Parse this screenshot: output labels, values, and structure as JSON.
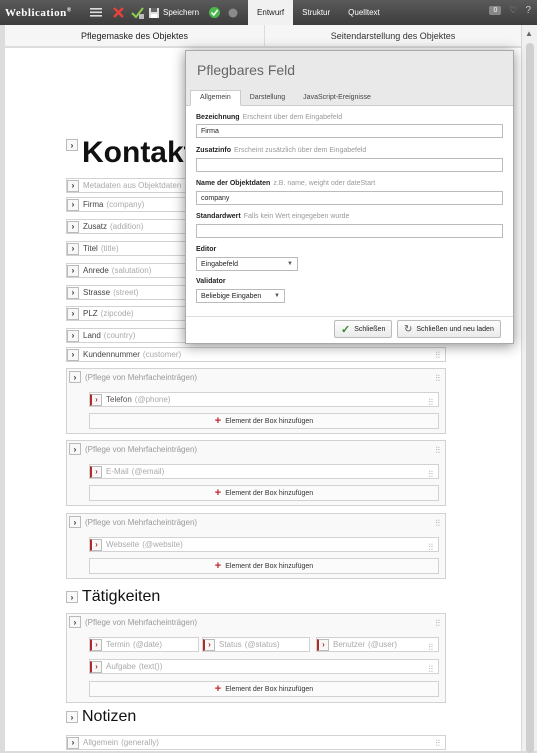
{
  "app": {
    "logo": "Weblication",
    "save_label": "Speichern",
    "tabs": [
      {
        "label": "Entwurf",
        "active": true
      },
      {
        "label": "Struktur",
        "active": false
      },
      {
        "label": "Quelltext",
        "active": false
      }
    ],
    "badge_count": "0",
    "help_label": "?"
  },
  "panels": {
    "left_title": "Pflegemaske des Objektes",
    "right_title": "Seitendarstellung des Objektes"
  },
  "main": {
    "heading_kontakt": "Kontakt",
    "fields": [
      {
        "name": "Metadaten aus Objektdaten",
        "param": ""
      },
      {
        "name": "Firma",
        "param": "(company)"
      },
      {
        "name": "Zusatz",
        "param": "(addition)"
      },
      {
        "name": "Titel",
        "param": "(title)"
      },
      {
        "name": "Anrede",
        "param": "(salutation)"
      },
      {
        "name": "Strasse",
        "param": "(street)"
      },
      {
        "name": "PLZ",
        "param": "(zipcode)"
      },
      {
        "name": "Land",
        "param": "(country)"
      },
      {
        "name": "Kundennummer",
        "param": "(customer)"
      }
    ],
    "box_title": "(Pflege von Mehrfacheinträgen)",
    "add_label": "Element der Box hinzufügen",
    "box_telefon": {
      "name": "Telefon",
      "param": "(@phone)"
    },
    "box_email": {
      "name": "E-Mail",
      "param": "(@email)"
    },
    "box_website": {
      "name": "Webseite",
      "param": "(@website)"
    },
    "heading_taetigkeiten": "Tätigkeiten",
    "termin": {
      "name": "Termin",
      "param": "(@date)"
    },
    "status": {
      "name": "Status",
      "param": "(@status)"
    },
    "benutzer": {
      "name": "Benutzer",
      "param": "(@user)"
    },
    "aufgabe": {
      "name": "Aufgabe",
      "param": "(text())"
    },
    "heading_notizen": "Notizen",
    "allgemein": {
      "name": "Allgemein",
      "param": "(generally)"
    }
  },
  "modal": {
    "title": "Pflegbares Feld",
    "tabs": [
      "Allgemein",
      "Darstellung",
      "JavaScript-Ereignisse"
    ],
    "bezeichnung_label": "Bezeichnung",
    "bezeichnung_hint": "Erscheint über dem Eingabefeld",
    "bezeichnung_value": "Firma",
    "zusatzinfo_label": "Zusatzinfo",
    "zusatzinfo_hint": "Erscheint zusätzlich über dem Eingabefeld",
    "zusatzinfo_value": "",
    "objektdaten_label": "Name der Objektdaten",
    "objektdaten_hint": "z.B. name, weight oder dateStart",
    "objektdaten_value": "company",
    "standardwert_label": "Standardwert",
    "standardwert_hint": "Falls kein Wert eingegeben wurde",
    "standardwert_value": "",
    "editor_label": "Editor",
    "editor_value": "Eingabefeld",
    "validator_label": "Validator",
    "validator_value": "Beliebige Eingaben",
    "close_label": "Schließen",
    "close_reload_label": "Schließen und neu laden"
  }
}
